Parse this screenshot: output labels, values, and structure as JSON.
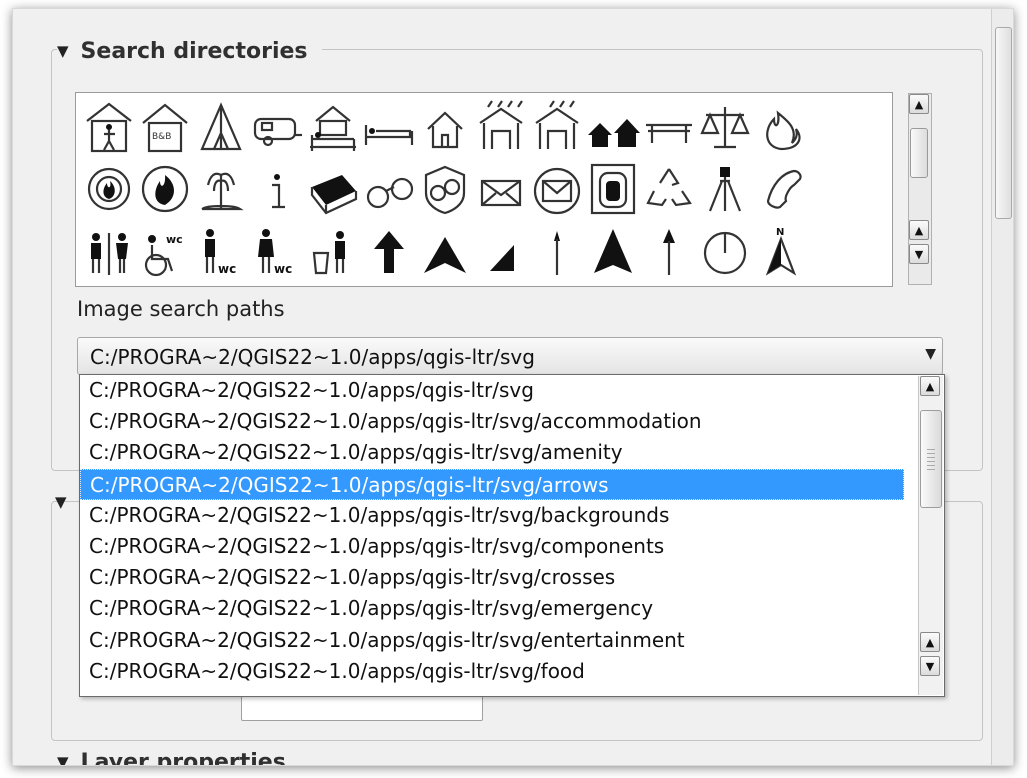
{
  "search_directories": {
    "title": "Search directories",
    "icons": [
      [
        "hiker-shelter-icon",
        "bed-and-breakfast-icon",
        "tent-icon",
        "caravan-icon",
        "hotel-icon",
        "bed-icon",
        "house-icon",
        "shelter-rain-icon",
        "shelter-icon",
        "two-houses-icon",
        "bench-icon",
        "courthouse-scales-icon",
        "fire-icon"
      ],
      [
        "fire-brigade-icon",
        "fire-station-icon",
        "fountain-icon",
        "information-icon",
        "book-icon",
        "handcuffs-icon",
        "police-badge-icon",
        "envelope-icon",
        "post-office-icon",
        "emergency-phone-box-icon",
        "recycling-icon",
        "survey-point-icon",
        "telephone-icon"
      ],
      [
        "toilets-icon",
        "wheelchair-wc-icon",
        "male-wc-icon",
        "female-wc-icon",
        "waste-basket-icon",
        "arrow-bold-icon",
        "arrow-chevron-icon",
        "arrow-half-icon",
        "arrow-thin-icon",
        "arrow-triangle-icon",
        "arrow-line-icon",
        "compass-circle-icon",
        "north-arrow-icon"
      ]
    ]
  },
  "image_search_paths": {
    "label": "Image search paths",
    "selected": "C:/PROGRA~2/QGIS22~1.0/apps/qgis-ltr/svg",
    "options": [
      "C:/PROGRA~2/QGIS22~1.0/apps/qgis-ltr/svg",
      "C:/PROGRA~2/QGIS22~1.0/apps/qgis-ltr/svg/accommodation",
      "C:/PROGRA~2/QGIS22~1.0/apps/qgis-ltr/svg/amenity",
      "C:/PROGRA~2/QGIS22~1.0/apps/qgis-ltr/svg/arrows",
      "C:/PROGRA~2/QGIS22~1.0/apps/qgis-ltr/svg/backgrounds",
      "C:/PROGRA~2/QGIS22~1.0/apps/qgis-ltr/svg/components",
      "C:/PROGRA~2/QGIS22~1.0/apps/qgis-ltr/svg/crosses",
      "C:/PROGRA~2/QGIS22~1.0/apps/qgis-ltr/svg/emergency",
      "C:/PROGRA~2/QGIS22~1.0/apps/qgis-ltr/svg/entertainment",
      "C:/PROGRA~2/QGIS22~1.0/apps/qgis-ltr/svg/food"
    ],
    "highlighted_index": 3
  },
  "bottom_section": {
    "title": "Layer properties"
  },
  "colors": {
    "highlight": "#3399ff",
    "panel": "#f0f0f0"
  }
}
